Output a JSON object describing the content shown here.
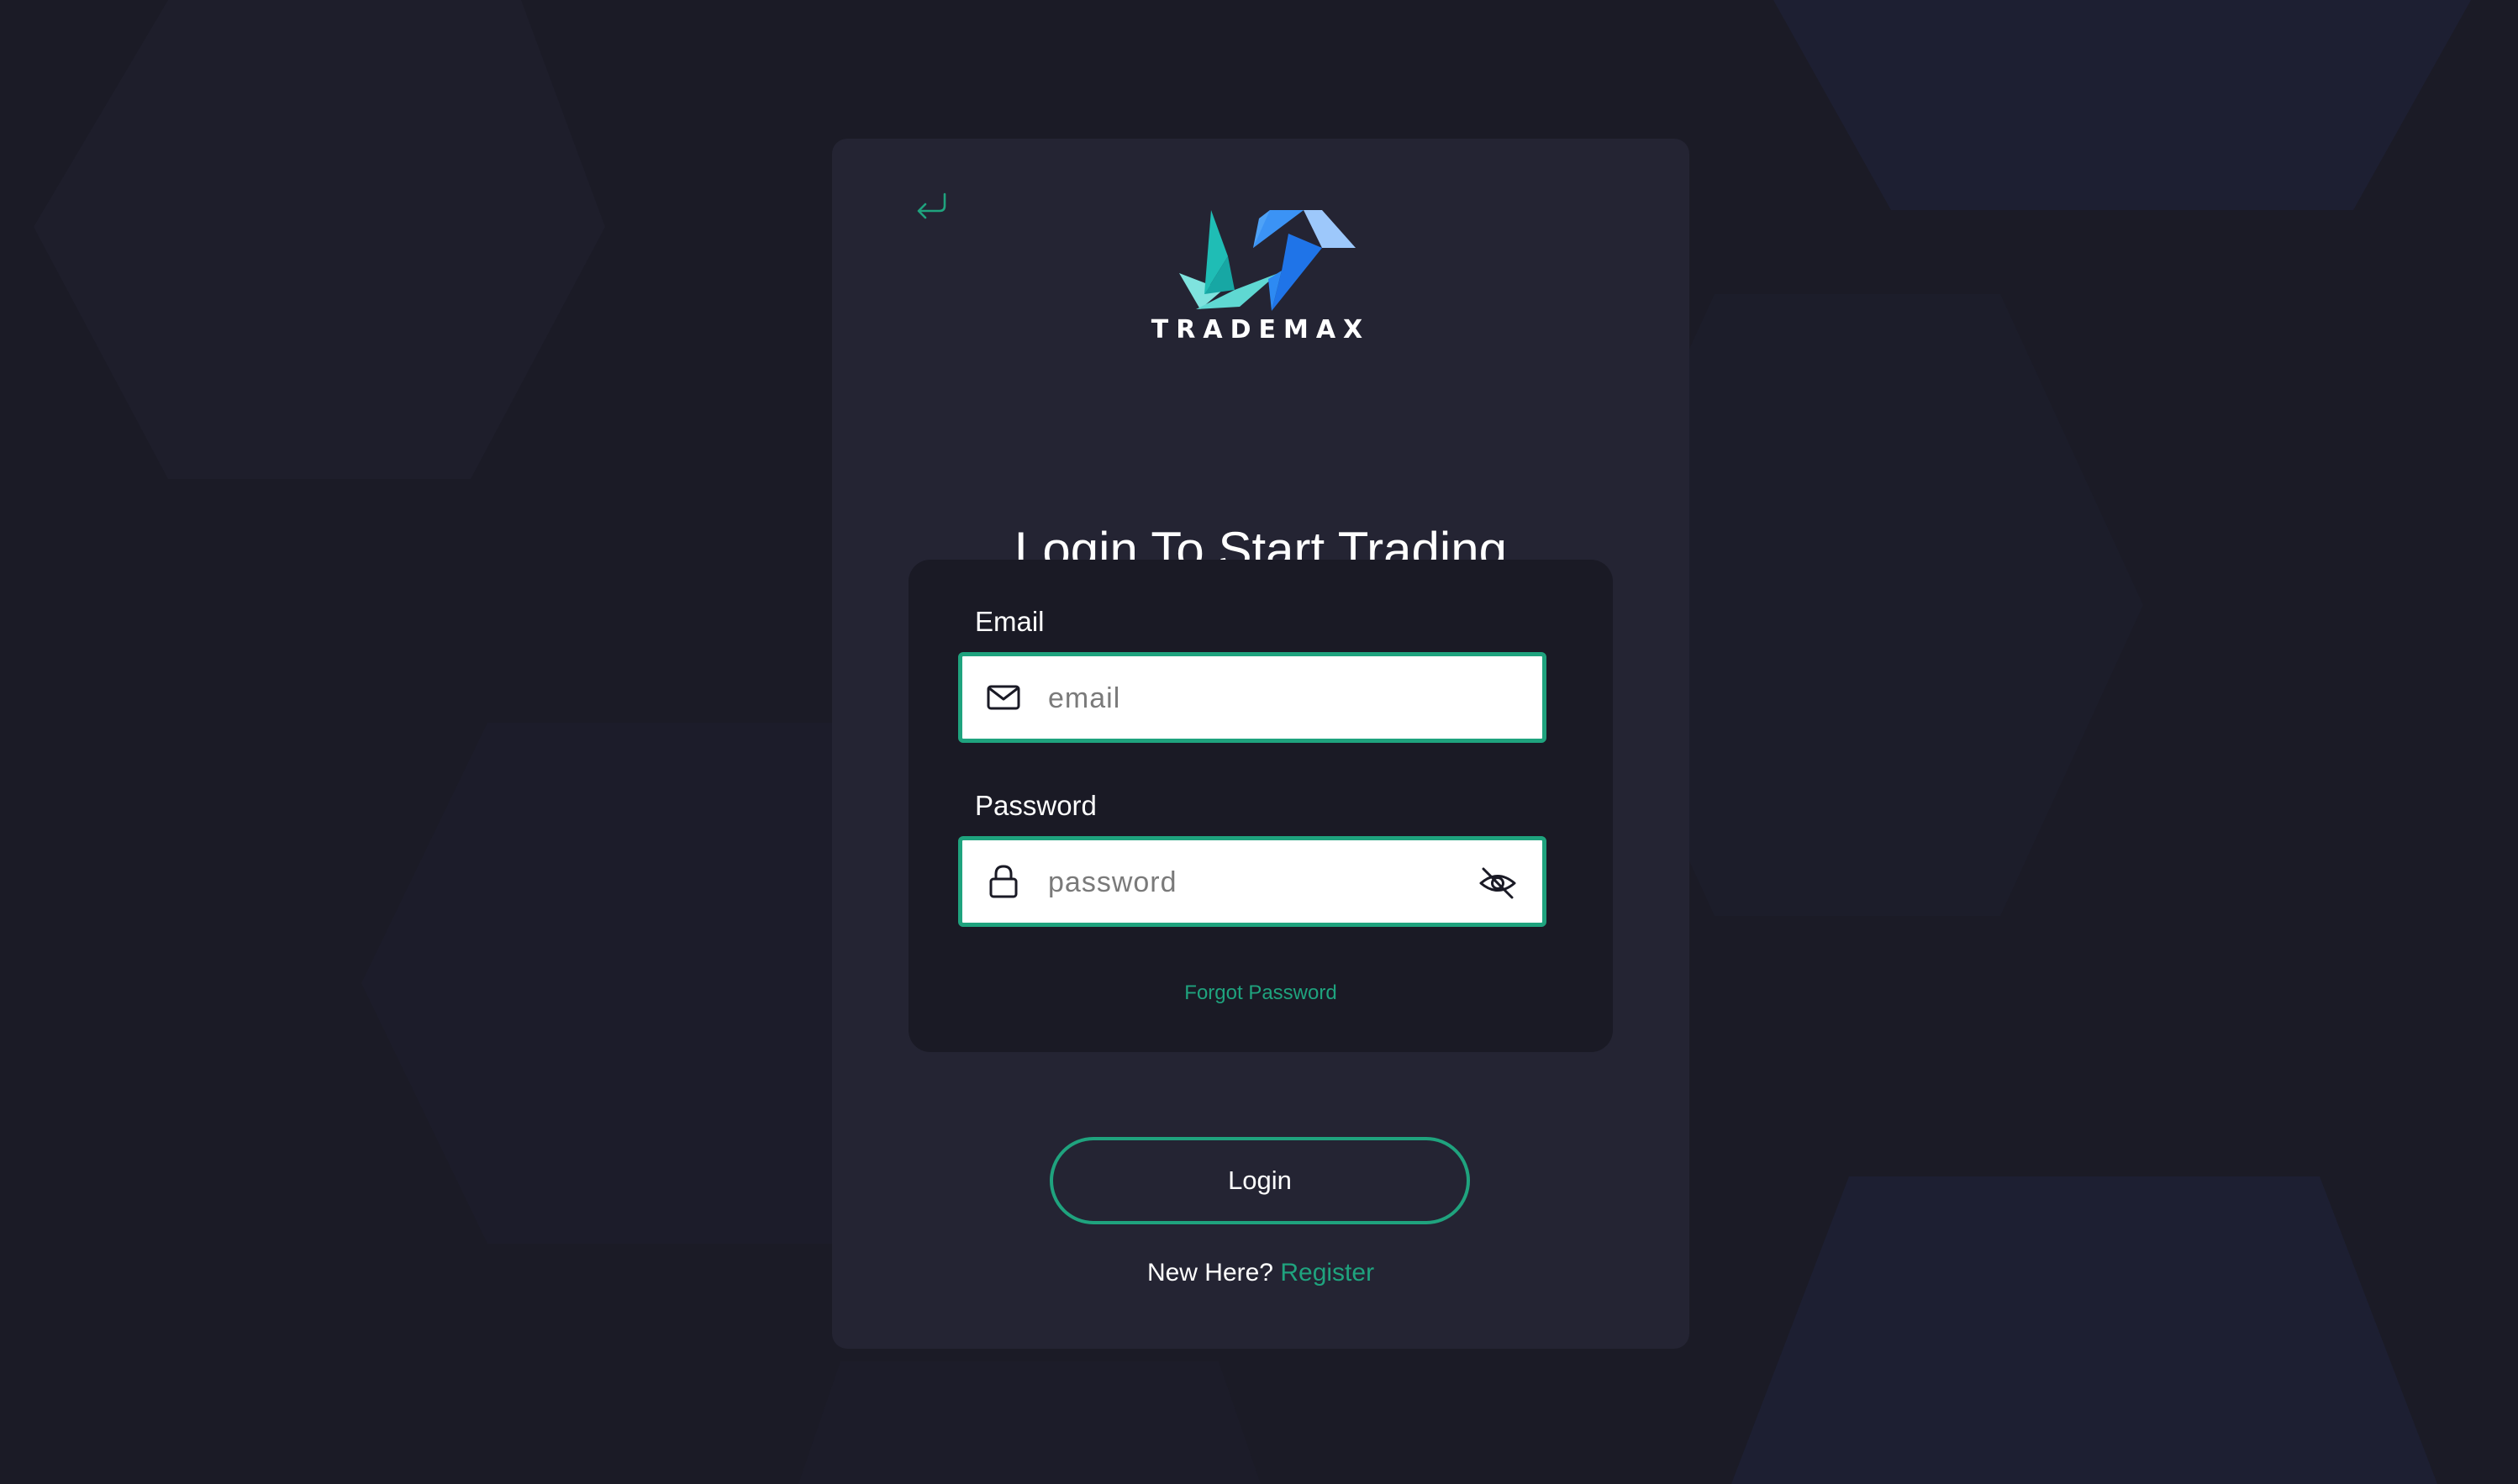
{
  "brand": {
    "name": "TRADEMAX"
  },
  "page": {
    "title": "Login To Start Trading"
  },
  "form": {
    "email": {
      "label": "Email",
      "placeholder": "email",
      "value": ""
    },
    "password": {
      "label": "Password",
      "placeholder": "password",
      "value": ""
    },
    "forgot_label": "Forgot Password"
  },
  "actions": {
    "login_label": "Login",
    "register_prompt": "New Here?",
    "register_label": "Register"
  },
  "icons": {
    "back": "return-arrow-icon",
    "email": "envelope-icon",
    "password": "lock-icon",
    "visibility": "eye-off-icon"
  },
  "colors": {
    "background": "#1b1b26",
    "card": "#242433",
    "panel": "#1a1a25",
    "accent": "#1fa37e",
    "logo_teal": "#1fbdb5",
    "logo_blue": "#2f86f5"
  }
}
